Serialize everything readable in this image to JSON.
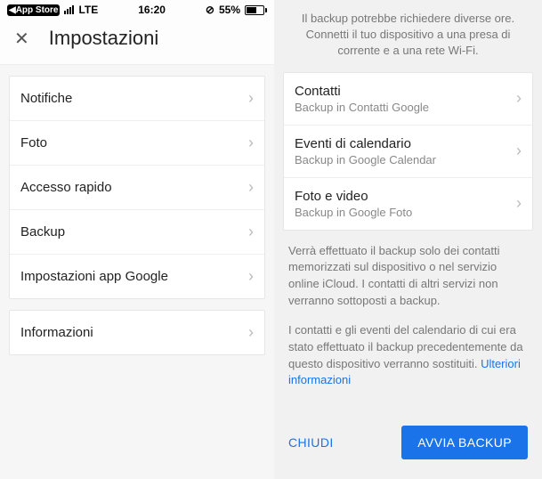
{
  "status": {
    "back_app": "App Store",
    "carrier": "LTE",
    "time": "16:20",
    "battery_percent": "55%"
  },
  "header": {
    "title": "Impostazioni"
  },
  "settings_group1": [
    {
      "label": "Notifiche"
    },
    {
      "label": "Foto"
    },
    {
      "label": "Accesso rapido"
    },
    {
      "label": "Backup"
    },
    {
      "label": "Impostazioni app Google"
    }
  ],
  "settings_group2": [
    {
      "label": "Informazioni"
    }
  ],
  "backup": {
    "intro": "Il backup potrebbe richiedere diverse ore. Connetti il tuo dispositivo a una presa di corrente e a una rete Wi-Fi.",
    "items": [
      {
        "title": "Contatti",
        "sub": "Backup in Contatti Google"
      },
      {
        "title": "Eventi di calendario",
        "sub": "Backup in Google Calendar"
      },
      {
        "title": "Foto e video",
        "sub": "Backup in Google Foto"
      }
    ],
    "note1": "Verrà effettuato il backup solo dei contatti memorizzati sul dispositivo o nel servizio online iCloud. I contatti di altri servizi non verranno sottoposti a backup.",
    "note2_prefix": "I contatti e gli eventi del calendario di cui era stato effettuato il backup precedentemente da questo dispositivo verranno sostituiti. ",
    "note2_link": "Ulteriori informazioni",
    "close_label": "CHIUDI",
    "start_label": "AVVIA BACKUP"
  }
}
